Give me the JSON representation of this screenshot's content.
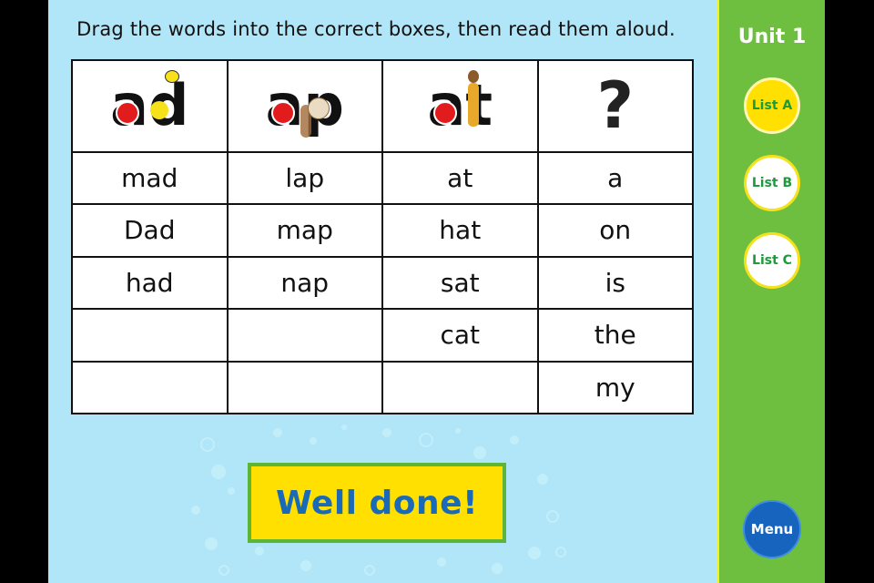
{
  "instruction": "Drag the words into the correct boxes, then read them aloud.",
  "table": {
    "headers": [
      {
        "label": "ad",
        "icon": "apple-duck-letters-icon"
      },
      {
        "label": "ap",
        "icon": "apple-dog-letters-icon"
      },
      {
        "label": "at",
        "icon": "apple-lady-letters-icon"
      },
      {
        "label": "?",
        "icon": "question-mark-icon"
      }
    ],
    "rows": [
      [
        "mad",
        "lap",
        "at",
        "a"
      ],
      [
        "Dad",
        "map",
        "hat",
        "on"
      ],
      [
        "had",
        "nap",
        "sat",
        "is"
      ],
      [
        "",
        "",
        "cat",
        "the"
      ],
      [
        "",
        "",
        "",
        "my"
      ]
    ]
  },
  "feedback": "Well done!",
  "sidebar": {
    "unit": "Unit 1",
    "lists": [
      {
        "label": "List A",
        "active": true
      },
      {
        "label": "List B",
        "active": false
      },
      {
        "label": "List C",
        "active": false
      }
    ],
    "menu": "Menu"
  },
  "colors": {
    "background": "#b1e5f8",
    "panel": "#6ebe3f",
    "active_list": "#ffe000",
    "feedback_text": "#1a6ab8",
    "menu_button": "#1764be"
  }
}
